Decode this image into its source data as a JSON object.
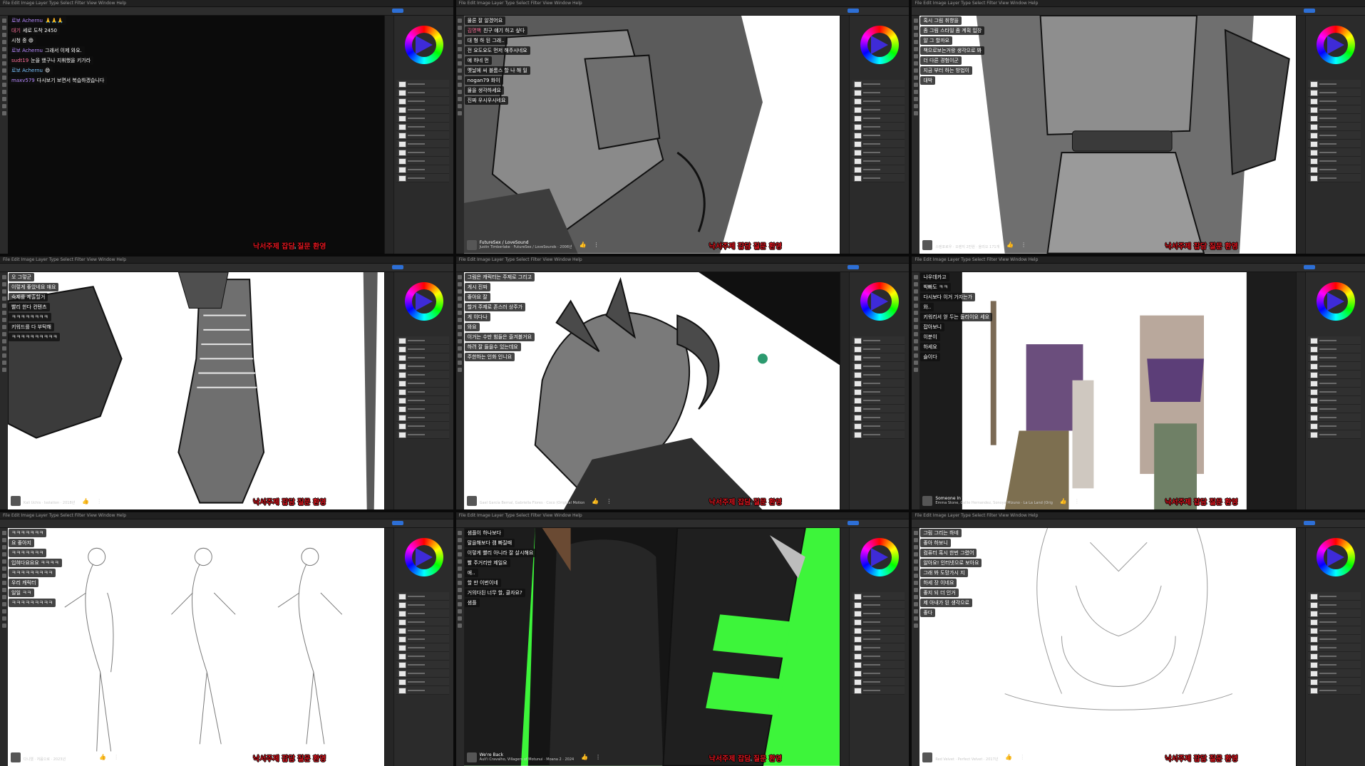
{
  "caption_overlay": "낙서주제 잡담 질문 환영",
  "colors": {
    "accent_red": "#e0161f",
    "ui_dark": "#262626",
    "share_blue": "#2d6fd6",
    "neon_green": "#3df53a"
  },
  "icons": {
    "like": "thumbs-up-icon",
    "volume": "volume-icon"
  },
  "glyphs": {
    "like": "👍",
    "volume": "🔈",
    "more": "⋮"
  },
  "panels": [
    {
      "theme": "dark",
      "chat": [
        {
          "name": "로보 Achernu",
          "text": "🙏🙏🙏"
        },
        {
          "name": "대기",
          "text": "세로 도착 2450"
        },
        {
          "name": "",
          "text": "시청 중 😄"
        },
        {
          "name": "로보 Achernu",
          "text": "그래서 이제 와요."
        },
        {
          "name": "sudt19",
          "text": "눈을 했구나 지휘했을 키가라"
        },
        {
          "name": "로보 Achernu",
          "text": "😄"
        },
        {
          "name": "maxv579",
          "text": "다시보기 보면서 복습하겠습니다"
        }
      ],
      "music": null
    },
    {
      "theme": "jacket",
      "chat": [
        {
          "name": "",
          "text": "물론 잘 알겠어요"
        },
        {
          "name": "김명백",
          "text": "친구 얘기 하고 싶다"
        },
        {
          "name": "",
          "text": "대 형 하 된 그래.."
        },
        {
          "name": "",
          "text": "전 요도요도 먼저 해주시네요"
        },
        {
          "name": "",
          "text": "얘 하네 먼"
        },
        {
          "name": "",
          "text": "옛날에 씨 블롬스 할 나 해 일"
        },
        {
          "name": "",
          "text": "nogan79 화이"
        },
        {
          "name": "",
          "text": "물을 생각하세요"
        },
        {
          "name": "",
          "text": "진짜 우시우시네요"
        }
      ],
      "music": {
        "title": "FutureSex / LoveSound",
        "artist": "Justin Timberlake · FutureSex / LoveSounds · 2006년"
      }
    },
    {
      "theme": "monster",
      "chat": [
        {
          "name": "",
          "text": "혹시 그림 취향을"
        },
        {
          "name": "",
          "text": "좀 그림 스타일 좀 계획 입장"
        },
        {
          "name": "",
          "text": "알 그 할까요"
        },
        {
          "name": "",
          "text": "책으로보는거랑 생각으로 봐"
        },
        {
          "name": "",
          "text": "더 다른 경험이군"
        },
        {
          "name": "",
          "text": "지금 부터 하는 방법이"
        },
        {
          "name": "",
          "text": "대박"
        }
      ],
      "music": {
        "title": "YOU (바다와 우연",
        "artist": "스텐포로우 · 오렌지 2만원 · 올리오 171개"
      }
    },
    {
      "theme": "boots",
      "chat": [
        {
          "name": "",
          "text": "오 그렇군"
        },
        {
          "name": "",
          "text": "이렇게 좋았네요 얘요"
        },
        {
          "name": "",
          "text": "숙제를 제출할거"
        },
        {
          "name": "",
          "text": "빨리 한다 컨텐츠"
        },
        {
          "name": "",
          "text": "ㅋㅋㅋㅋㅋㅋㅋㅋ"
        },
        {
          "name": "",
          "text": "키워드를 다 부탁해"
        },
        {
          "name": "",
          "text": "ㅋㅋㅋㅋㅋㅋㅋㅋㅋㅋ"
        }
      ],
      "music": {
        "title": "Feel Like A Fool",
        "artist": "Kali Uchis · Isolation · 2018년"
      }
    },
    {
      "theme": "head",
      "chat": [
        {
          "name": "",
          "text": "그림은 캐릭터는 주제로 그리고"
        },
        {
          "name": "",
          "text": "게시 진짜"
        },
        {
          "name": "",
          "text": "좋아요 잘"
        },
        {
          "name": "",
          "text": "할거 주제로 존스러 상주가"
        },
        {
          "name": "",
          "text": "게 이다나"
        },
        {
          "name": "",
          "text": "와요"
        },
        {
          "name": "",
          "text": "이거는 수만 힘들은 즐겨볼거요"
        },
        {
          "name": "",
          "text": "하려 잘 들을수 있는데요"
        },
        {
          "name": "",
          "text": "주한하는 인화 인니요"
        }
      ],
      "music": {
        "title": "Remember Me (Lullaby)",
        "artist": "Gael García Bernal, Gabriella Flores · Coco (Original Motion"
      }
    },
    {
      "theme": "scene",
      "chat": [
        {
          "name": "",
          "text": "나우데카고"
        },
        {
          "name": "",
          "text": "박빠도 ㅋㅋ"
        },
        {
          "name": "",
          "text": "다시보다 이거 가자는가"
        },
        {
          "name": "",
          "text": "와.."
        },
        {
          "name": "",
          "text": "키워리서 얻 두는 돌리이요 세요"
        },
        {
          "name": "",
          "text": "잡아보니"
        },
        {
          "name": "",
          "text": "이분이"
        },
        {
          "name": "",
          "text": "하세요"
        },
        {
          "name": "",
          "text": "슬이다"
        }
      ],
      "music": {
        "title": "Someone In The Crowd",
        "artist": "Emma Stone, Callie Hernandez, Sonoya Mizuno · La La Land (Orig"
      }
    },
    {
      "theme": "sketch",
      "chat": [
        {
          "name": "",
          "text": "ㅋㅋㅋㅋㅋㅋㅋ"
        },
        {
          "name": "",
          "text": "요 좋아지"
        },
        {
          "name": "",
          "text": "ㅋㅋㅋㅋㅋㅋㅋ"
        },
        {
          "name": "",
          "text": "입혀다요요요 ㅋㅋㅋㅋ"
        },
        {
          "name": "",
          "text": "ㅋㅋㅋㅋㅋㅋㅋㅋㅋ"
        },
        {
          "name": "",
          "text": "우리 캐릭터"
        },
        {
          "name": "",
          "text": "일일 ㅋㅋ"
        },
        {
          "name": "",
          "text": "ㅋㅋㅋㅋㅋㅋㅋㅋㅋ"
        }
      ],
      "music": {
        "title": "처음으로 (영화 인어공주 한국어 OST)",
        "artist": "다니엘 · 처음으로 · 2023년"
      }
    },
    {
      "theme": "neon",
      "chat": [
        {
          "name": "",
          "text": "샘플이 하나보다"
        },
        {
          "name": "",
          "text": "말을해보다 캠 빠질때"
        },
        {
          "name": "",
          "text": "이렇게 빨리 아니라 잘 살시해요"
        },
        {
          "name": "",
          "text": "빨 주거리만 제일요"
        },
        {
          "name": "",
          "text": "애.."
        },
        {
          "name": "",
          "text": "할 만 이번이네"
        },
        {
          "name": "",
          "text": "거의다된 너무 할, 클자요?"
        },
        {
          "name": "",
          "text": "샘플"
        }
      ],
      "music": {
        "title": "We're Back",
        "artist": "Auli'i Cravalho, Villagers of Motunui · Moana 2 · 2024"
      }
    },
    {
      "theme": "lines",
      "chat": [
        {
          "name": "",
          "text": "그림 그리는 하네"
        },
        {
          "name": "",
          "text": "좋아 하보니"
        },
        {
          "name": "",
          "text": "컴퓨터 혹시 한번 그렸어"
        },
        {
          "name": "",
          "text": "알아요! 인터넷으로 보아요"
        },
        {
          "name": "",
          "text": "그래 봐 도망가시 지"
        },
        {
          "name": "",
          "text": "하세 장 이네요"
        },
        {
          "name": "",
          "text": "좋지 되 더 인거"
        },
        {
          "name": "",
          "text": "제 아내가 된 생각으로"
        },
        {
          "name": "",
          "text": "좋다"
        }
      ],
      "music": {
        "title": "About Love",
        "artist": "Red Velvet · Perfect Velvet · 2017년"
      }
    }
  ]
}
